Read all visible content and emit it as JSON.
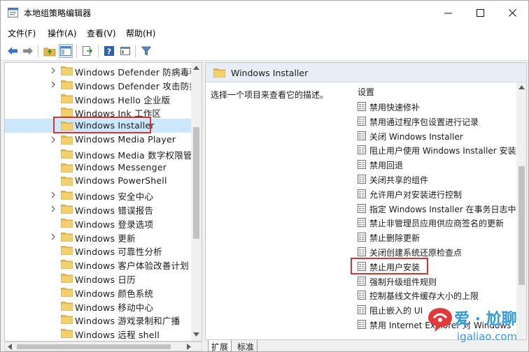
{
  "window": {
    "title": "本地组策略编辑器"
  },
  "menu": [
    {
      "label": "文件(F)"
    },
    {
      "label": "操作(A)"
    },
    {
      "label": "查看(V)"
    },
    {
      "label": "帮助(H)"
    }
  ],
  "tree": {
    "items": [
      {
        "label": "Windows Defender 防病毒程",
        "expandable": true
      },
      {
        "label": "Windows Defender 攻击防护",
        "expandable": true
      },
      {
        "label": "Windows Hello 企业版",
        "expandable": false
      },
      {
        "label": "Windows Ink 工作区",
        "expandable": false
      },
      {
        "label": "Windows Installer",
        "expandable": false,
        "selected": true
      },
      {
        "label": "Windows Media Player",
        "expandable": true
      },
      {
        "label": "Windows Media 数字权限管理",
        "expandable": false
      },
      {
        "label": "Windows Messenger",
        "expandable": false
      },
      {
        "label": "Windows PowerShell",
        "expandable": false
      },
      {
        "label": "Windows 安全中心",
        "expandable": true
      },
      {
        "label": "Windows 错误报告",
        "expandable": true
      },
      {
        "label": "Windows 登录选项",
        "expandable": false
      },
      {
        "label": "Windows 更新",
        "expandable": true
      },
      {
        "label": "Windows 可靠性分析",
        "expandable": false
      },
      {
        "label": "Windows 客户体验改善计划",
        "expandable": false
      },
      {
        "label": "Windows 日历",
        "expandable": false
      },
      {
        "label": "Windows 颜色系统",
        "expandable": false
      },
      {
        "label": "Windows 移动中心",
        "expandable": false
      },
      {
        "label": "Windows 游戏录制和广播",
        "expandable": false
      },
      {
        "label": "Windows 远程 shell",
        "expandable": false
      }
    ]
  },
  "details": {
    "header_title": "Windows Installer",
    "description": "选择一个项目来查看它的描述。",
    "column_header": "设置",
    "settings": [
      {
        "label": "禁用快速修补"
      },
      {
        "label": "禁用通过程序包设置进行记录"
      },
      {
        "label": "关闭 Windows Installer"
      },
      {
        "label": "阻止用户使用 Windows Installer 安装"
      },
      {
        "label": "禁用回退"
      },
      {
        "label": "关闭共享的组件"
      },
      {
        "label": "允许用户对安装进行控制"
      },
      {
        "label": "指定 Windows Installer 在事务日志中"
      },
      {
        "label": "禁止非管理员应用供应商签名的更新"
      },
      {
        "label": "禁止删除更新"
      },
      {
        "label": "关闭创建系统还原检查点"
      },
      {
        "label": "禁止用户安装"
      },
      {
        "label": "强制升级组件规则"
      },
      {
        "label": "控制基线文件缓存大小的上限"
      },
      {
        "label": "阻止嵌入的 UI"
      },
      {
        "label": "禁用 Internet Explorer 对 Windows"
      }
    ]
  },
  "tabs": [
    {
      "label": "扩展"
    },
    {
      "label": "标准"
    }
  ],
  "watermark": {
    "text": "爱 · 尬聊",
    "url": "igaliao.com"
  },
  "colors": {
    "highlight": "#e0302e",
    "selection": "#cce8ff",
    "header_bg": "#e8eef6",
    "folder": "#e8b84a",
    "watermark": "#2e9ad8"
  }
}
